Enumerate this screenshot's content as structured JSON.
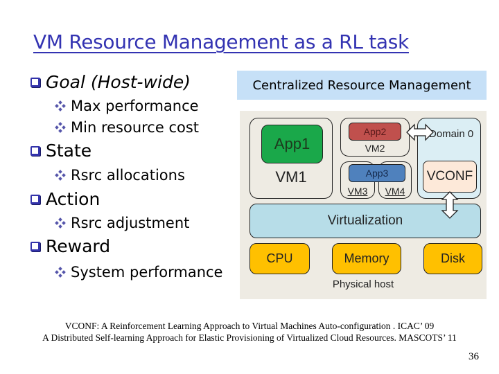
{
  "slide": {
    "title": "VM Resource Management as a RL task",
    "page_number": "36"
  },
  "bullets": [
    {
      "label": "Goal (Host-wide)",
      "subitems": [
        "Max performance",
        "Min resource cost"
      ]
    },
    {
      "label": "State",
      "subitems": [
        "Rsrc allocations"
      ]
    },
    {
      "label": "Action",
      "subitems": [
        "Rsrc adjustment"
      ]
    },
    {
      "label": "Reward",
      "subitems": [
        "System performance"
      ]
    }
  ],
  "diagram": {
    "header": "Centralized Resource Management",
    "vm1": {
      "label": "VM1",
      "app": "App1"
    },
    "vm2": {
      "label": "VM2",
      "app": "App2"
    },
    "vm3": {
      "label": "VM3"
    },
    "vm4": {
      "label": "VM4"
    },
    "app3": "App3",
    "domain0": {
      "label": "Domain 0",
      "component": "VCONF"
    },
    "virtualization": "Virtualization",
    "resources": [
      "CPU",
      "Memory",
      "Disk"
    ],
    "host_label": "Physical host",
    "colors": {
      "app1": "#1aa84a",
      "app2": "#c0504d",
      "app3": "#4f81bd",
      "domain0": "#dbeef4",
      "vconf": "#fde9d9",
      "virtualization": "#b7dde8",
      "resource": "#ffc000",
      "background": "#eeebe3"
    }
  },
  "references": [
    "VCONF: A Reinforcement Learning Approach to Virtual Machines Auto-configuration . ICAC’ 09",
    "A Distributed Self-learning Approach for Elastic Provisioning of Virtualized Cloud Resources. MASCOTS’ 11"
  ]
}
